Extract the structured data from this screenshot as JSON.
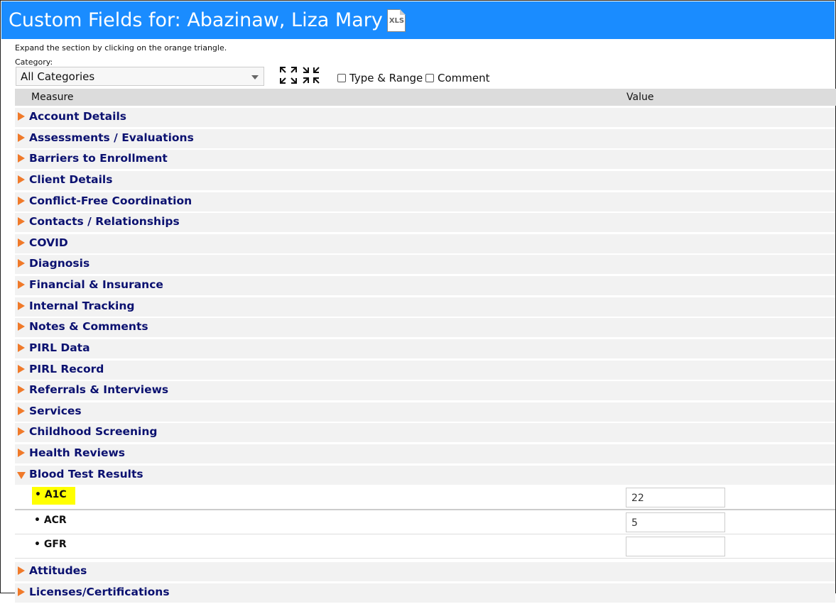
{
  "header": {
    "title": "Custom Fields for: Abazinaw, Liza Mary",
    "export_icon": "xls-file-icon",
    "export_label": "XLS",
    "bg": "#1a8cff"
  },
  "hint": "Expand the section by clicking on the orange triangle.",
  "category": {
    "label": "Category:",
    "value": "All Categories"
  },
  "toolbar": {
    "expand_icon": "expand-all-icon",
    "collapse_icon": "collapse-all-icon",
    "type_range_label": "Type & Range",
    "comment_label": "Comment"
  },
  "grid": {
    "col_measure": "Measure",
    "col_value": "Value"
  },
  "sections": [
    "Account Details",
    "Assessments / Evaluations",
    "Barriers to Enrollment",
    "Client Details",
    "Conflict-Free Coordination",
    "Contacts / Relationships",
    "COVID",
    "Diagnosis",
    "Financial & Insurance",
    "Internal Tracking",
    "Notes & Comments",
    "PIRL Data",
    "PIRL Record",
    "Referrals & Interviews",
    "Services",
    "Childhood Screening",
    "Health Reviews",
    "Blood Test Results"
  ],
  "blood_test": {
    "items": [
      {
        "label": "• A1C",
        "value": "22"
      },
      {
        "label": "• ACR",
        "value": "5"
      },
      {
        "label": "• GFR",
        "value": ""
      }
    ]
  },
  "after_sections": [
    "Attitudes",
    "Licenses/Certifications"
  ],
  "colors": {
    "triangle": "#f07a2a",
    "section_text": "#0b1170",
    "highlight": "#ffff00"
  }
}
